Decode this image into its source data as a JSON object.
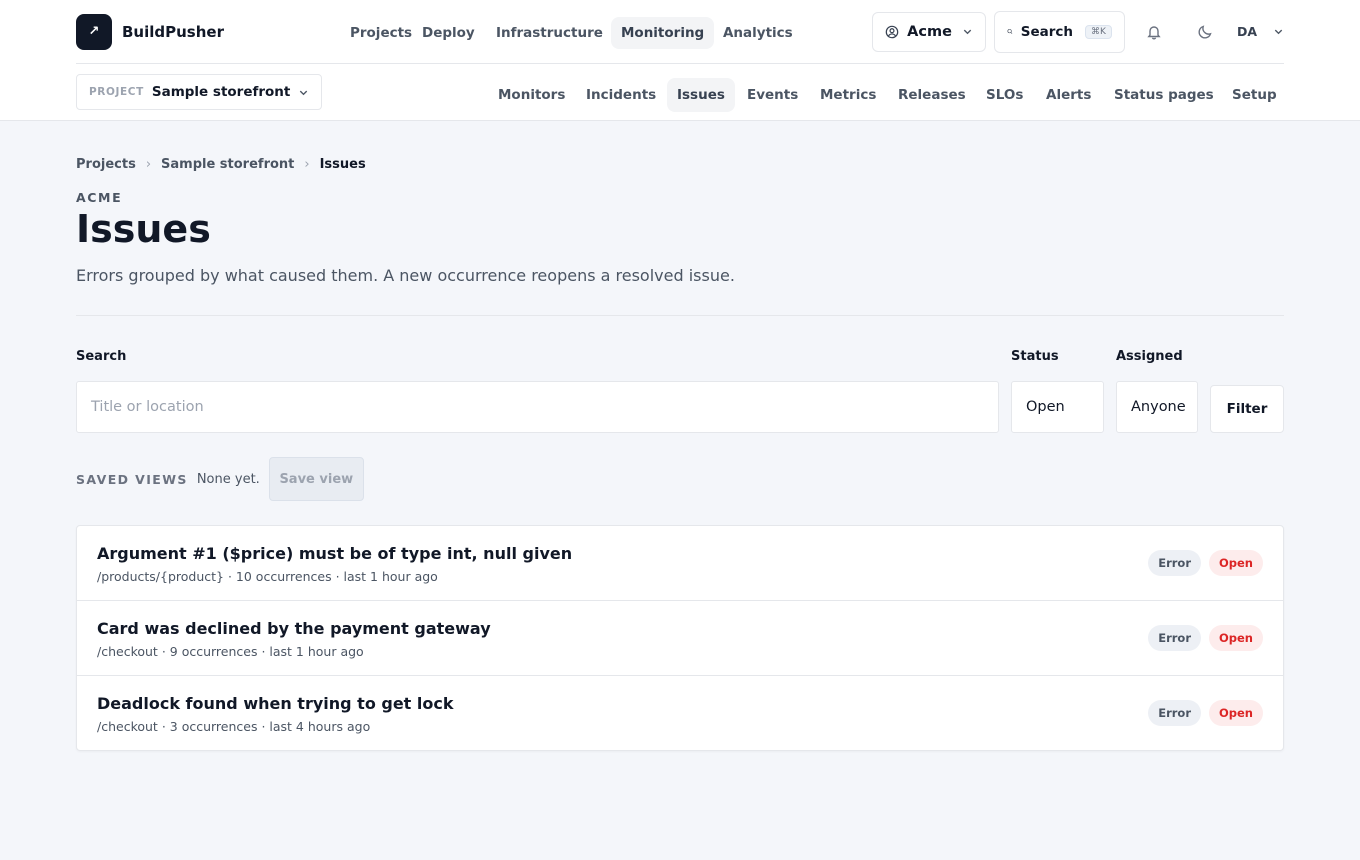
{
  "app": {
    "logo_glyph": "↗",
    "name": "BuildPusher"
  },
  "main_nav": [
    "Projects",
    "Deploy",
    "Infrastructure",
    "Monitoring",
    "Analytics"
  ],
  "main_nav_active": "Monitoring",
  "org": {
    "name": "Acme",
    "icon": "user-circle-icon"
  },
  "search": {
    "label": "Search",
    "shortcut": "⌘K"
  },
  "user": {
    "initials": "DA"
  },
  "project": {
    "kicker": "PROJECT",
    "name": "Sample storefront"
  },
  "sub_nav": [
    "Monitors",
    "Incidents",
    "Issues",
    "Events",
    "Metrics",
    "Releases",
    "SLOs",
    "Alerts",
    "Status pages",
    "Setup"
  ],
  "sub_nav_active": "Issues",
  "breadcrumb": [
    "Projects",
    "Sample storefront",
    "Issues"
  ],
  "page": {
    "org_kicker": "ACME",
    "title": "Issues",
    "description": "Errors grouped by what caused them. A new occurrence reopens a resolved issue."
  },
  "filters": {
    "search_label": "Search",
    "search_placeholder": "Title or location",
    "status_label": "Status",
    "status_value": "Open",
    "assigned_label": "Assigned",
    "assigned_value": "Anyone",
    "filter_button": "Filter"
  },
  "saved_views": {
    "label": "SAVED VIEWS",
    "empty_text": "None yet.",
    "save_button": "Save view"
  },
  "issues": [
    {
      "title": "Argument #1 ($price) must be of type int, null given",
      "location": "/products/{product}",
      "occurrences": "10 occurrences",
      "last_seen": "last 1 hour ago",
      "level": "Error",
      "status": "Open"
    },
    {
      "title": "Card was declined by the payment gateway",
      "location": "/checkout",
      "occurrences": "9 occurrences",
      "last_seen": "last 1 hour ago",
      "level": "Error",
      "status": "Open"
    },
    {
      "title": "Deadlock found when trying to get lock",
      "location": "/checkout",
      "occurrences": "3 occurrences",
      "last_seen": "last 4 hours ago",
      "level": "Error",
      "status": "Open"
    }
  ],
  "colors": {
    "accent": "#111827",
    "open_status": "#dc2626",
    "background": "#f4f6fa"
  }
}
